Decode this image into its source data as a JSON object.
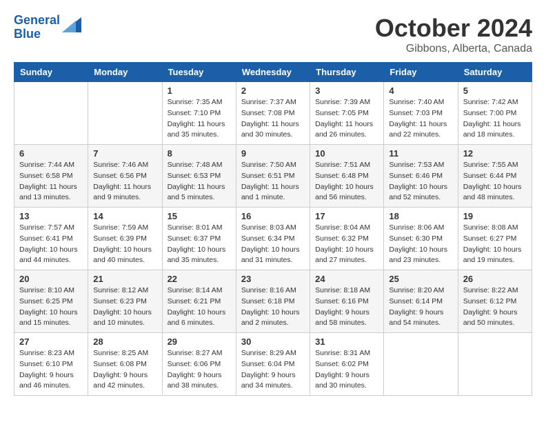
{
  "header": {
    "logo_line1": "General",
    "logo_line2": "Blue",
    "month": "October 2024",
    "location": "Gibbons, Alberta, Canada"
  },
  "days_of_week": [
    "Sunday",
    "Monday",
    "Tuesday",
    "Wednesday",
    "Thursday",
    "Friday",
    "Saturday"
  ],
  "weeks": [
    [
      {
        "day": "",
        "info": ""
      },
      {
        "day": "",
        "info": ""
      },
      {
        "day": "1",
        "info": "Sunrise: 7:35 AM\nSunset: 7:10 PM\nDaylight: 11 hours and 35 minutes."
      },
      {
        "day": "2",
        "info": "Sunrise: 7:37 AM\nSunset: 7:08 PM\nDaylight: 11 hours and 30 minutes."
      },
      {
        "day": "3",
        "info": "Sunrise: 7:39 AM\nSunset: 7:05 PM\nDaylight: 11 hours and 26 minutes."
      },
      {
        "day": "4",
        "info": "Sunrise: 7:40 AM\nSunset: 7:03 PM\nDaylight: 11 hours and 22 minutes."
      },
      {
        "day": "5",
        "info": "Sunrise: 7:42 AM\nSunset: 7:00 PM\nDaylight: 11 hours and 18 minutes."
      }
    ],
    [
      {
        "day": "6",
        "info": "Sunrise: 7:44 AM\nSunset: 6:58 PM\nDaylight: 11 hours and 13 minutes."
      },
      {
        "day": "7",
        "info": "Sunrise: 7:46 AM\nSunset: 6:56 PM\nDaylight: 11 hours and 9 minutes."
      },
      {
        "day": "8",
        "info": "Sunrise: 7:48 AM\nSunset: 6:53 PM\nDaylight: 11 hours and 5 minutes."
      },
      {
        "day": "9",
        "info": "Sunrise: 7:50 AM\nSunset: 6:51 PM\nDaylight: 11 hours and 1 minute."
      },
      {
        "day": "10",
        "info": "Sunrise: 7:51 AM\nSunset: 6:48 PM\nDaylight: 10 hours and 56 minutes."
      },
      {
        "day": "11",
        "info": "Sunrise: 7:53 AM\nSunset: 6:46 PM\nDaylight: 10 hours and 52 minutes."
      },
      {
        "day": "12",
        "info": "Sunrise: 7:55 AM\nSunset: 6:44 PM\nDaylight: 10 hours and 48 minutes."
      }
    ],
    [
      {
        "day": "13",
        "info": "Sunrise: 7:57 AM\nSunset: 6:41 PM\nDaylight: 10 hours and 44 minutes."
      },
      {
        "day": "14",
        "info": "Sunrise: 7:59 AM\nSunset: 6:39 PM\nDaylight: 10 hours and 40 minutes."
      },
      {
        "day": "15",
        "info": "Sunrise: 8:01 AM\nSunset: 6:37 PM\nDaylight: 10 hours and 35 minutes."
      },
      {
        "day": "16",
        "info": "Sunrise: 8:03 AM\nSunset: 6:34 PM\nDaylight: 10 hours and 31 minutes."
      },
      {
        "day": "17",
        "info": "Sunrise: 8:04 AM\nSunset: 6:32 PM\nDaylight: 10 hours and 27 minutes."
      },
      {
        "day": "18",
        "info": "Sunrise: 8:06 AM\nSunset: 6:30 PM\nDaylight: 10 hours and 23 minutes."
      },
      {
        "day": "19",
        "info": "Sunrise: 8:08 AM\nSunset: 6:27 PM\nDaylight: 10 hours and 19 minutes."
      }
    ],
    [
      {
        "day": "20",
        "info": "Sunrise: 8:10 AM\nSunset: 6:25 PM\nDaylight: 10 hours and 15 minutes."
      },
      {
        "day": "21",
        "info": "Sunrise: 8:12 AM\nSunset: 6:23 PM\nDaylight: 10 hours and 10 minutes."
      },
      {
        "day": "22",
        "info": "Sunrise: 8:14 AM\nSunset: 6:21 PM\nDaylight: 10 hours and 6 minutes."
      },
      {
        "day": "23",
        "info": "Sunrise: 8:16 AM\nSunset: 6:18 PM\nDaylight: 10 hours and 2 minutes."
      },
      {
        "day": "24",
        "info": "Sunrise: 8:18 AM\nSunset: 6:16 PM\nDaylight: 9 hours and 58 minutes."
      },
      {
        "day": "25",
        "info": "Sunrise: 8:20 AM\nSunset: 6:14 PM\nDaylight: 9 hours and 54 minutes."
      },
      {
        "day": "26",
        "info": "Sunrise: 8:22 AM\nSunset: 6:12 PM\nDaylight: 9 hours and 50 minutes."
      }
    ],
    [
      {
        "day": "27",
        "info": "Sunrise: 8:23 AM\nSunset: 6:10 PM\nDaylight: 9 hours and 46 minutes."
      },
      {
        "day": "28",
        "info": "Sunrise: 8:25 AM\nSunset: 6:08 PM\nDaylight: 9 hours and 42 minutes."
      },
      {
        "day": "29",
        "info": "Sunrise: 8:27 AM\nSunset: 6:06 PM\nDaylight: 9 hours and 38 minutes."
      },
      {
        "day": "30",
        "info": "Sunrise: 8:29 AM\nSunset: 6:04 PM\nDaylight: 9 hours and 34 minutes."
      },
      {
        "day": "31",
        "info": "Sunrise: 8:31 AM\nSunset: 6:02 PM\nDaylight: 9 hours and 30 minutes."
      },
      {
        "day": "",
        "info": ""
      },
      {
        "day": "",
        "info": ""
      }
    ]
  ]
}
